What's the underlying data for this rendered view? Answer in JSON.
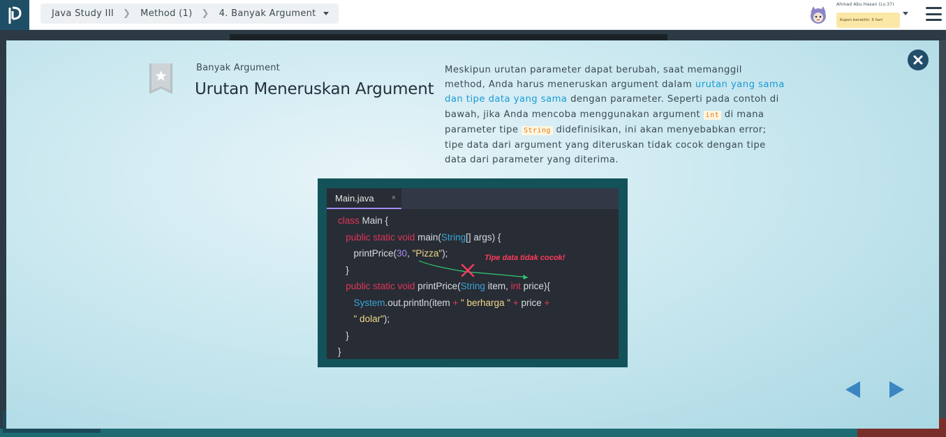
{
  "header": {
    "breadcrumb": [
      "Java Study III",
      "Method (1)",
      "4. Banyak Argument"
    ],
    "user_name": "Ahmad Abu Hasan (Lv.37)",
    "coupon_text": "Kupon berakhir: 5 hari"
  },
  "slide": {
    "subtitle": "Banyak Argument",
    "title": "Urutan Meneruskan Argument",
    "desc": {
      "p1": "Meskipun urutan parameter dapat berubah, saat memanggil method, Anda harus meneruskan argument dalam ",
      "p1_highlight": "urutan yang sama dan tipe data yang sama",
      "p2": " dengan parameter. Seperti pada contoh di bawah, jika Anda mencoba menggunakan argument ",
      "code1": "int",
      "p3": " di mana parameter tipe ",
      "code2": "String",
      "p4": " didefinisikan, ini akan menyebabkan error; tipe data dari argument yang diteruskan tidak cocok dengan tipe data dari parameter yang diterima."
    },
    "code": {
      "tab_name": "Main.java",
      "tab_close": "×",
      "error_label": "Tipe data tidak cocok!",
      "line1_kw": "class",
      "line1_rest": " Main {",
      "line2_kw": "public static void",
      "line2_name": " main(",
      "line2_type": "String",
      "line2_rest": "[] args) {",
      "line3_call": "printPrice(",
      "line3_num": "30",
      "line3_sep": ", ",
      "line3_str": "\"Pizza\"",
      "line3_end": ");",
      "line4": "}",
      "line5_kw": "public static void",
      "line5_name": " printPrice(",
      "line5_type1": "String",
      "line5_p1": " item, ",
      "line5_type2": "int",
      "line5_p2": " price){",
      "line6_sys": "System",
      "line6_rest": ".out.println(item ",
      "line6_op1": "+",
      "line6_str": " \" berharga \" ",
      "line6_op2": "+",
      "line6_price": " price ",
      "line6_op3": "+",
      "line7_str": "\" dolar\"",
      "line7_end": ");",
      "line8": "}",
      "line9": "}"
    }
  },
  "colors": {
    "accent": "#1a9ad6",
    "close": "#234e6a",
    "nav": "#3b86c2",
    "error": "#ff3b5c"
  }
}
